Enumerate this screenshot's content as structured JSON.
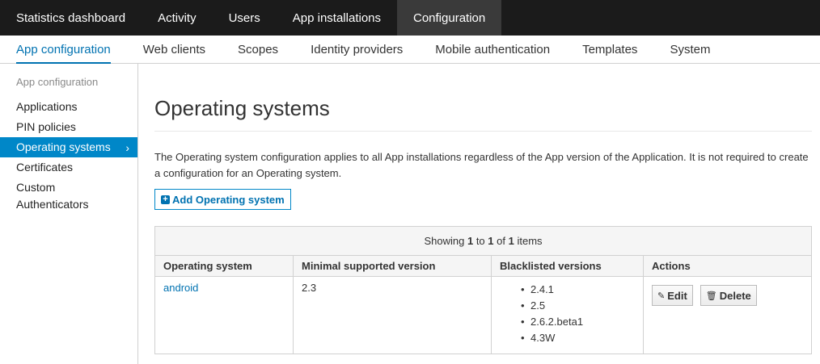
{
  "topnav": {
    "tabs": [
      {
        "label": "Statistics dashboard"
      },
      {
        "label": "Activity"
      },
      {
        "label": "Users"
      },
      {
        "label": "App installations"
      },
      {
        "label": "Configuration",
        "active": true
      }
    ]
  },
  "subnav": {
    "tabs": [
      {
        "label": "App configuration",
        "active": true
      },
      {
        "label": "Web clients"
      },
      {
        "label": "Scopes"
      },
      {
        "label": "Identity providers"
      },
      {
        "label": "Mobile authentication"
      },
      {
        "label": "Templates"
      },
      {
        "label": "System"
      }
    ]
  },
  "sidebar": {
    "heading": "App configuration",
    "items": [
      {
        "label": "Applications"
      },
      {
        "label": "PIN policies"
      },
      {
        "label": "Operating systems",
        "active": true
      },
      {
        "label": "Certificates"
      },
      {
        "label": "Custom Authenticators"
      }
    ],
    "active_chevron": "chevron-right-icon"
  },
  "main": {
    "title": "Operating systems",
    "description": "The Operating system configuration applies to all App installations regardless of the App version of the Application. It is not required to create a configuration for an Operating system.",
    "add_button": {
      "icon": "plus-square-icon",
      "label": "Add Operating system"
    },
    "table": {
      "summary": {
        "prefix": "Showing",
        "from": "1",
        "to_word": "to",
        "to": "1",
        "of_word": "of",
        "total": "1",
        "suffix": "items"
      },
      "columns": [
        "Operating system",
        "Minimal supported version",
        "Blacklisted versions",
        "Actions"
      ],
      "rows": [
        {
          "os": "android",
          "min_version": "2.3",
          "blacklisted": [
            "2.4.1",
            "2.5",
            "2.6.2.beta1",
            "4.3W"
          ],
          "edit_label": "Edit",
          "delete_label": "Delete"
        }
      ]
    }
  },
  "colors": {
    "topnav_bg": "#1b1b1b",
    "topnav_active": "#3a3a3a",
    "accent": "#0072b1",
    "sidebar_active": "#0087c8"
  }
}
